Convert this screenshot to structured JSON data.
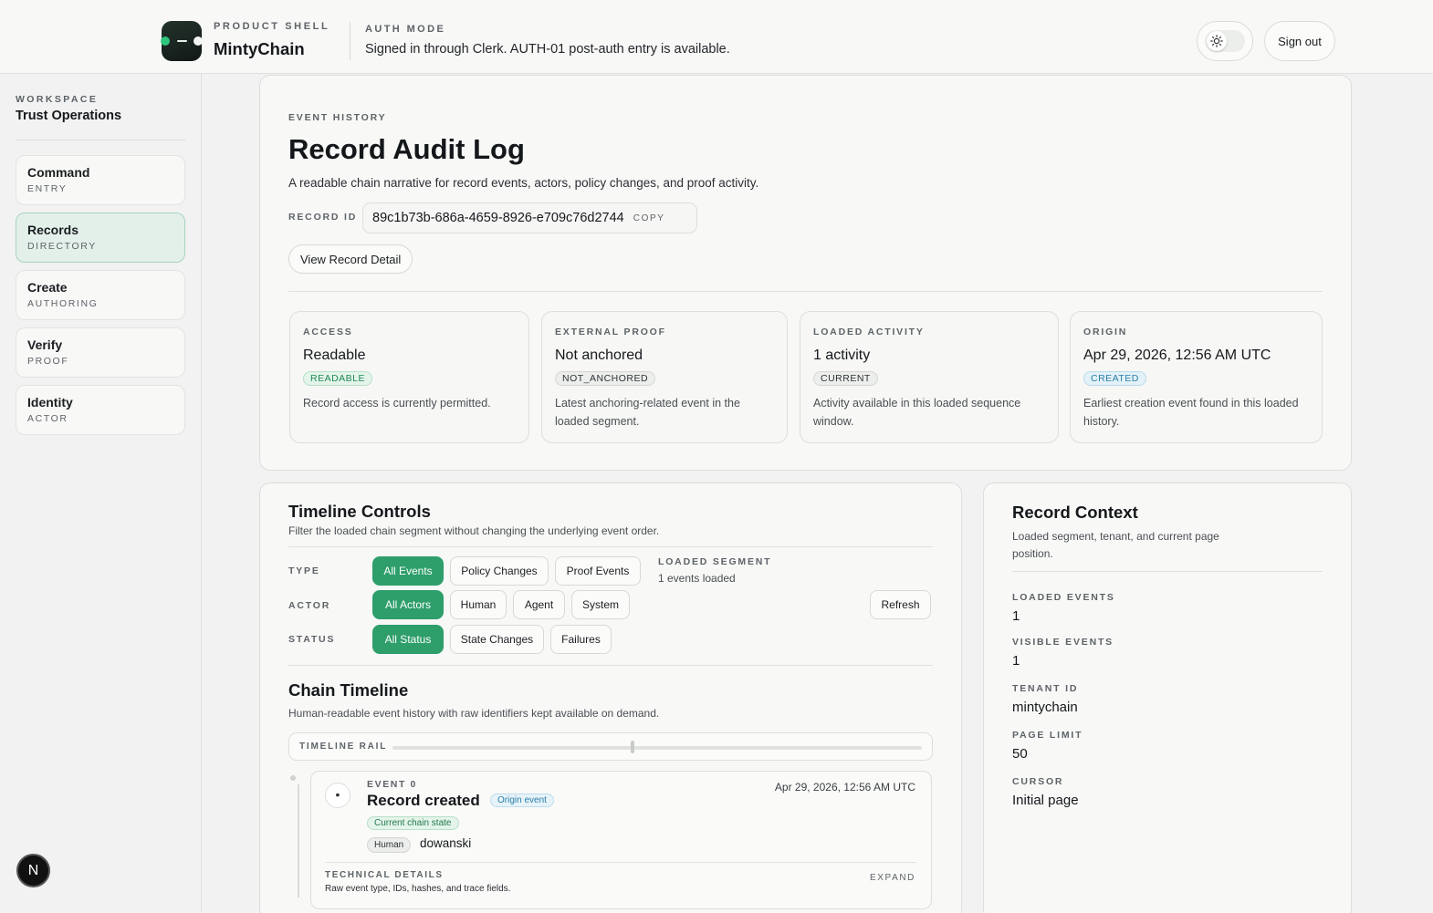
{
  "header": {
    "brand_eyebrow": "PRODUCT SHELL",
    "brand_name": "MintyChain",
    "auth_eyebrow": "AUTH MODE",
    "auth_text": "Signed in through Clerk. AUTH-01 post-auth entry is available.",
    "theme_toggle_icon": "sun-icon",
    "sign_out_label": "Sign out"
  },
  "sidebar": {
    "workspace_eyebrow": "WORKSPACE",
    "workspace_name": "Trust Operations",
    "items": [
      {
        "label": "Command",
        "sub": "ENTRY",
        "active": false
      },
      {
        "label": "Records",
        "sub": "DIRECTORY",
        "active": true
      },
      {
        "label": "Create",
        "sub": "AUTHORING",
        "active": false
      },
      {
        "label": "Verify",
        "sub": "PROOF",
        "active": false
      },
      {
        "label": "Identity",
        "sub": "ACTOR",
        "active": false
      }
    ],
    "badge_letter": "N"
  },
  "audit": {
    "eyebrow": "EVENT HISTORY",
    "title": "Record Audit Log",
    "description": "A readable chain narrative for record events, actors, policy changes, and proof activity.",
    "record_id_label": "RECORD ID",
    "record_id": "89c1b73b-686a-4659-8926-e709c76d2744",
    "copy_label": "COPY",
    "view_detail_label": "View Record Detail",
    "stats": [
      {
        "eyebrow": "ACCESS",
        "value": "Readable",
        "pill": "READABLE",
        "pill_color": "#1f8a55",
        "desc": "Record access is currently permitted."
      },
      {
        "eyebrow": "EXTERNAL PROOF",
        "value": "Not anchored",
        "pill": "NOT_ANCHORED",
        "pill_color": "#2e3236",
        "desc": "Latest anchoring-related event in the loaded segment."
      },
      {
        "eyebrow": "LOADED ACTIVITY",
        "value": "1 activity",
        "pill": "CURRENT",
        "pill_color": "#2e3236",
        "desc": "Activity available in this loaded sequence window."
      },
      {
        "eyebrow": "ORIGIN",
        "value": "Apr 29, 2026, 12:56 AM UTC",
        "pill": "CREATED",
        "pill_color": "#2a7fa8",
        "desc": "Earliest creation event found in this loaded history."
      }
    ]
  },
  "timeline_controls": {
    "title": "Timeline Controls",
    "description": "Filter the loaded chain segment without changing the underlying event order.",
    "type_label": "TYPE",
    "type_options": [
      "All Events",
      "Policy Changes",
      "Proof Events"
    ],
    "actor_label": "ACTOR",
    "actor_options": [
      "All Actors",
      "Human",
      "Agent",
      "System"
    ],
    "status_label": "STATUS",
    "status_options": [
      "All Status",
      "State Changes",
      "Failures"
    ],
    "segment_eyebrow": "LOADED SEGMENT",
    "segment_value": "1 events loaded",
    "refresh_label": "Refresh"
  },
  "chain_timeline": {
    "title": "Chain Timeline",
    "description": "Human-readable event history with raw identifiers kept available on demand.",
    "rail_label": "TIMELINE RAIL",
    "event": {
      "eyebrow": "EVENT 0",
      "title": "Record created",
      "origin_tag": "Origin event",
      "time": "Apr 29, 2026, 12:56 AM UTC",
      "state_tag": "Current chain state",
      "actor_type": "Human",
      "actor_name": "dowanski",
      "tech_eyebrow": "TECHNICAL DETAILS",
      "tech_desc": "Raw event type, IDs, hashes, and trace fields.",
      "expand_label": "EXPAND"
    }
  },
  "record_context": {
    "title": "Record Context",
    "description": "Loaded segment, tenant, and current page position.",
    "fields": [
      {
        "label": "LOADED EVENTS",
        "value": "1"
      },
      {
        "label": "VISIBLE EVENTS",
        "value": "1"
      },
      {
        "label": "TENANT ID",
        "value": "mintychain"
      },
      {
        "label": "PAGE LIMIT",
        "value": "50"
      },
      {
        "label": "CURSOR",
        "value": "Initial page"
      }
    ]
  },
  "colors": {
    "accent": "#2e9e6b",
    "active_nav_bg": "#e3f0ea"
  }
}
